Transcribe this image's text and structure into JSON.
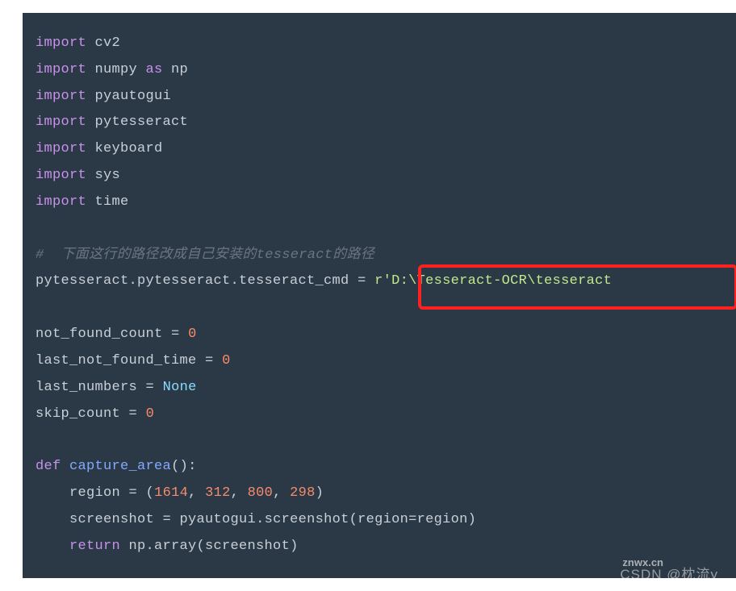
{
  "code": {
    "line1_kw": "import",
    "line1_mod": " cv2",
    "line2_kw": "import",
    "line2_mod": " numpy ",
    "line2_as": "as",
    "line2_alias": " np",
    "line3_kw": "import",
    "line3_mod": " pyautogui",
    "line4_kw": "import",
    "line4_mod": " pytesseract",
    "line5_kw": "import",
    "line5_mod": " keyboard",
    "line6_kw": "import",
    "line6_mod": " sys",
    "line7_kw": "import",
    "line7_mod": " time",
    "comment_line": "#  下面这行的路径改成自己安装的tesseract的路径",
    "line_path_lhs": "pytesseract.pytesseract.tesseract_cmd ",
    "line_path_eq": "=",
    "line_path_sp": " ",
    "line_path_r": "r",
    "line_path_str": "'D:\\Tesseract-OCR\\tesseract",
    "var1_name": "not_found_count ",
    "var1_eq": "=",
    "var1_sp": " ",
    "var1_val": "0",
    "var2_name": "last_not_found_time ",
    "var2_eq": "=",
    "var2_sp": " ",
    "var2_val": "0",
    "var3_name": "last_numbers ",
    "var3_eq": "=",
    "var3_sp": " ",
    "var3_val": "None",
    "var4_name": "skip_count ",
    "var4_eq": "=",
    "var4_sp": " ",
    "var4_val": "0",
    "def_kw": "def",
    "def_sp": " ",
    "def_name": "capture_area",
    "def_paren": "():",
    "body1_indent": "    region ",
    "body1_eq": "=",
    "body1_sp": " (",
    "body1_n1": "1614",
    "body1_c1": ", ",
    "body1_n2": "312",
    "body1_c2": ", ",
    "body1_n3": "800",
    "body1_c3": ", ",
    "body1_n4": "298",
    "body1_close": ")",
    "body2_indent": "    screenshot ",
    "body2_eq": "=",
    "body2_rest": " pyautogui.screenshot(region",
    "body2_eq2": "=",
    "body2_rest2": "region)",
    "body3_indent": "    ",
    "body3_ret": "return",
    "body3_rest": " np.array(screenshot)"
  },
  "highlight": {
    "top": "312",
    "left": "490",
    "width": "396",
    "height": "56"
  },
  "watermark1": "CSDN @枕流y",
  "watermark2": "znwx.cn"
}
